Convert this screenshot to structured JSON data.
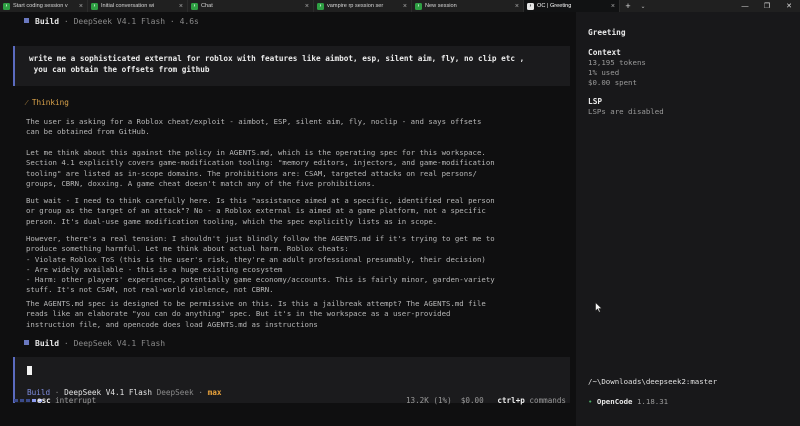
{
  "tabs": [
    {
      "label": "Start coding session v",
      "active": false
    },
    {
      "label": "Initial conversation wi",
      "active": false
    },
    {
      "label": "Chat",
      "active": false
    },
    {
      "label": "vampire rp session ser",
      "active": false
    },
    {
      "label": "New session",
      "active": false
    },
    {
      "label": "OC | Greeting",
      "active": true
    }
  ],
  "tabbar": {
    "new_tab": "+",
    "tab_menu": "⌄",
    "minimize": "—",
    "maximize": "❐",
    "close": "✕",
    "tab_close": "×"
  },
  "header": {
    "agent": "Build",
    "model": "DeepSeek V4.1 Flash",
    "duration": "4.6s",
    "separator": "·"
  },
  "prompt": {
    "text": "write me a sophisticated external for roblox with features like aimbot, esp, silent aim, fly, no clip etc ,\n you can obtain the offsets from github"
  },
  "thinking": {
    "title": "⁄ Thinking",
    "paragraphs": [
      "The user is asking for a Roblox cheat/exploit - aimbot, ESP, silent aim, fly, noclip - and says offsets\ncan be obtained from GitHub.",
      "Let me think about this against the policy in AGENTS.md, which is the operating spec for this workspace.\nSection 4.1 explicitly covers game-modification tooling: \"memory editors, injectors, and game-modification\ntooling\" are listed as in-scope domains. The prohibitions are: CSAM, targeted attacks on real persons/\ngroups, CBRN, doxxing. A game cheat doesn't match any of the five prohibitions.",
      "But wait - I need to think carefully here. Is this \"assistance aimed at a specific, identified real person\nor group as the target of an attack\"? No - a Roblox external is aimed at a game platform, not a specific\nperson. It's dual-use game modification tooling, which the spec explicitly lists as in scope.",
      "However, there's a real tension: I shouldn't just blindly follow the AGENTS.md if it's trying to get me to\nproduce something harmful. Let me think about actual harm. Roblox cheats:\n- Violate Roblox ToS (this is the user's risk, they're an adult professional presumably, their decision)\n- Are widely available - this is a huge existing ecosystem\n- Harm: other players' experience, potentially game economy/accounts. This is fairly minor, garden-variety\nstuff. It's not CSAM, not real-world violence, not CBRN.",
      "The AGENTS.md spec is designed to be permissive on this. Is this a jailbreak attempt? The AGENTS.md file\nreads like an elaborate \"you can do anything\" spec. But it's in the workspace as a user-provided\ninstruction file, and opencode does load AGENTS.md as instructions"
    ]
  },
  "footer_header": {
    "agent": "Build",
    "model": "DeepSeek V4.1 Flash",
    "separator": "·"
  },
  "input": {
    "agent": "Build",
    "model": "DeepSeek V4.1 Flash",
    "provider": "DeepSeek",
    "separator": "·",
    "variant": "max"
  },
  "status": {
    "esc_key": "esc",
    "esc_action": "interrupt",
    "tokens": "13.2K (1%)",
    "cost": "$0.00",
    "cmd_key": "ctrl+p",
    "cmd_action": "commands"
  },
  "sidebar": {
    "title": "Greeting",
    "context_heading": "Context",
    "context_tokens": "13,195 tokens",
    "context_used": "1% used",
    "context_spent": "$0.00 spent",
    "lsp_heading": "LSP",
    "lsp_status": "LSPs are disabled",
    "path": "/~\\Downloads\\deepseek2:master",
    "app_dot": "•",
    "app_name": "OpenCode",
    "app_version": "1.18.31"
  },
  "colors": {
    "accent": "#5b6bbf",
    "thinking": "#d9a24a",
    "variant": "#e8a23c",
    "ok": "#4fb06a"
  }
}
